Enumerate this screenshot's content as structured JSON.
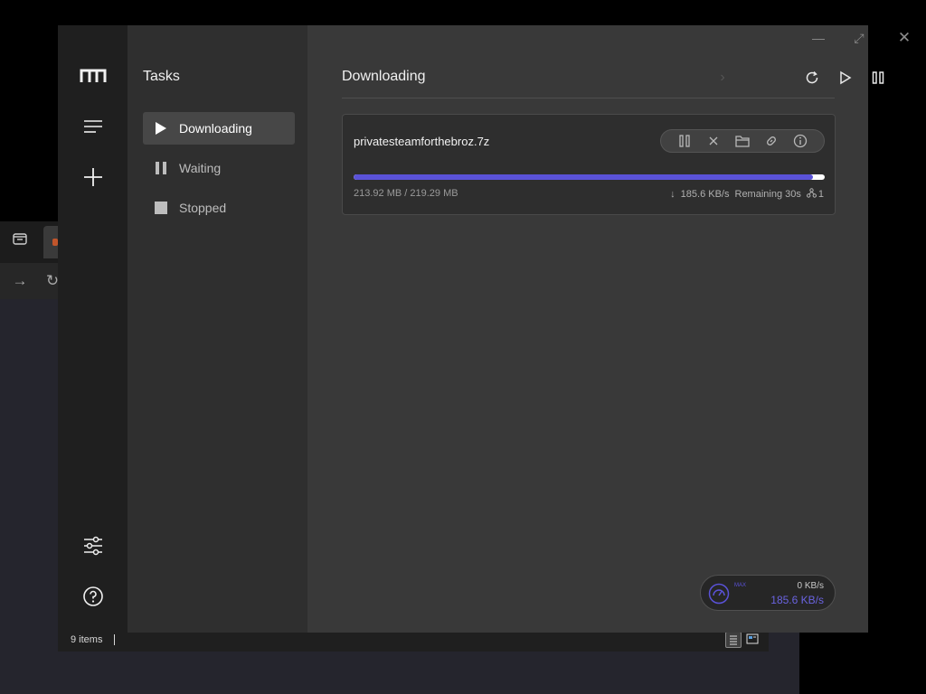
{
  "background_window": {
    "status_items": "9 items"
  },
  "sidebar": {
    "title": "Tasks",
    "items": [
      {
        "label": "Downloading",
        "active": true
      },
      {
        "label": "Waiting",
        "active": false
      },
      {
        "label": "Stopped",
        "active": false
      }
    ]
  },
  "main": {
    "title": "Downloading"
  },
  "task": {
    "name": "privatesteamforthebroz.7z",
    "size_text": "213.92 MB / 219.29 MB",
    "speed": "185.6 KB/s",
    "remaining": "Remaining 30s",
    "connections": "1",
    "progress": 0.9755
  },
  "speedometer": {
    "small_label": "MAX",
    "upload": "0 KB/s",
    "download": "185.6 KB/s"
  },
  "colors": {
    "accent": "#5a52d8",
    "background": "#393939"
  }
}
